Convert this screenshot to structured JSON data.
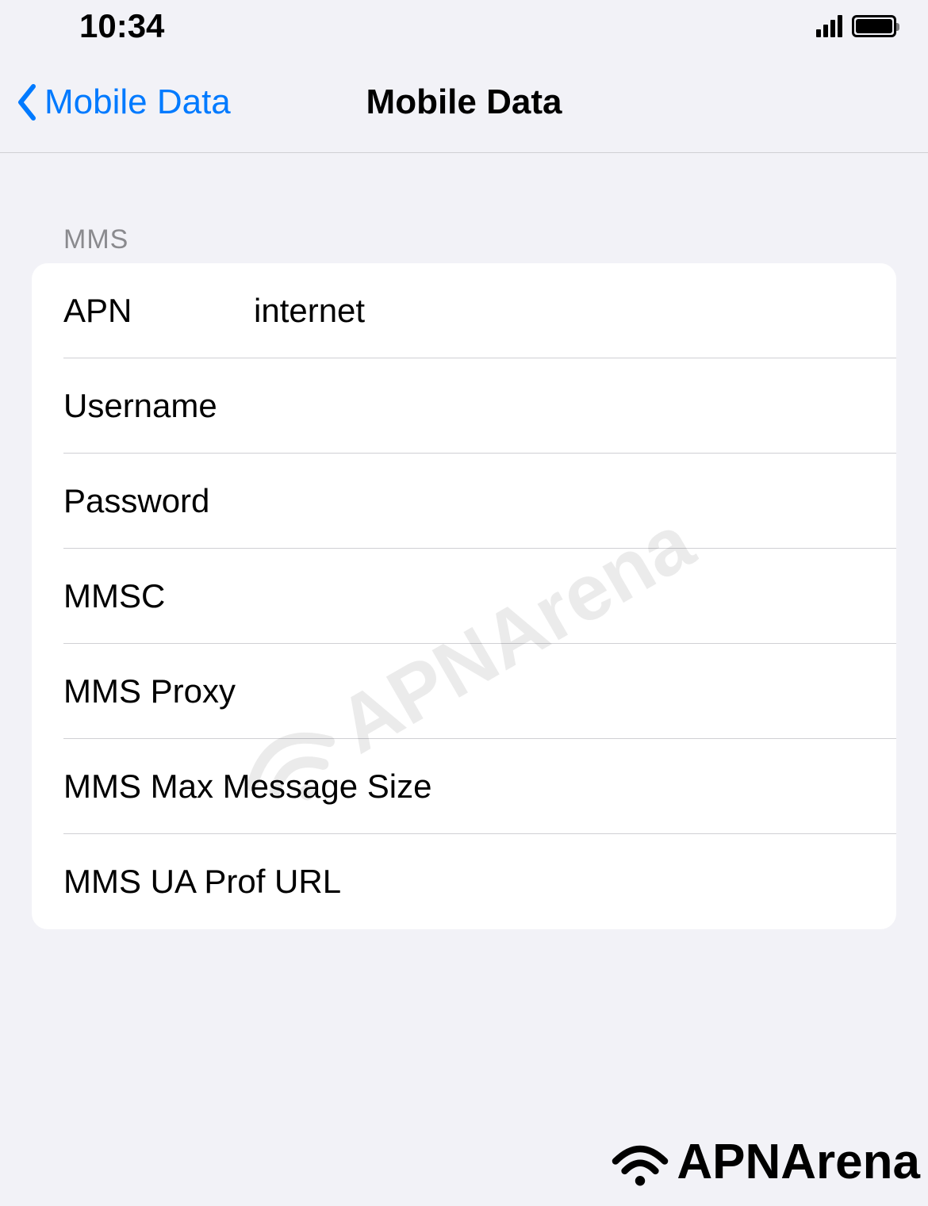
{
  "statusBar": {
    "time": "10:34"
  },
  "nav": {
    "backLabel": "Mobile Data",
    "title": "Mobile Data"
  },
  "section": {
    "header": "MMS",
    "rows": [
      {
        "label": "APN",
        "value": "internet"
      },
      {
        "label": "Username",
        "value": ""
      },
      {
        "label": "Password",
        "value": ""
      },
      {
        "label": "MMSC",
        "value": ""
      },
      {
        "label": "MMS Proxy",
        "value": ""
      },
      {
        "label": "MMS Max Message Size",
        "value": ""
      },
      {
        "label": "MMS UA Prof URL",
        "value": ""
      }
    ]
  },
  "watermark": {
    "text": "APNArena"
  },
  "footer": {
    "brand": "APNArena"
  }
}
